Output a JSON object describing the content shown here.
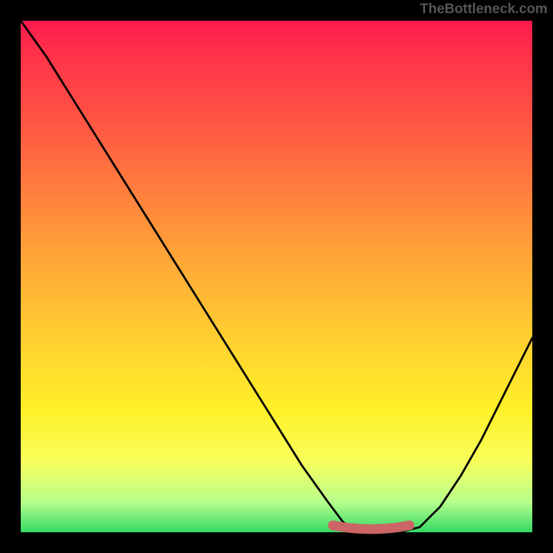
{
  "watermark": "TheBottleneck.com",
  "chart_data": {
    "type": "line",
    "title": "",
    "xlabel": "",
    "ylabel": "",
    "xlim": [
      0,
      100
    ],
    "ylim": [
      0,
      100
    ],
    "series": [
      {
        "name": "bottleneck-curve",
        "x": [
          0,
          5,
          10,
          15,
          20,
          25,
          30,
          35,
          40,
          45,
          50,
          55,
          60,
          63,
          66,
          70,
          74,
          78,
          82,
          86,
          90,
          94,
          98,
          100
        ],
        "y": [
          100,
          93,
          85,
          77,
          69,
          61,
          53,
          45,
          37,
          29,
          21,
          13,
          6,
          2,
          0,
          0,
          0,
          1,
          5,
          11,
          18,
          26,
          34,
          38
        ]
      }
    ],
    "gradient_stops": [
      {
        "pos": 0.0,
        "color": "#ff1a4d"
      },
      {
        "pos": 0.18,
        "color": "#ff5044"
      },
      {
        "pos": 0.46,
        "color": "#ffa538"
      },
      {
        "pos": 0.76,
        "color": "#fff028"
      },
      {
        "pos": 0.94,
        "color": "#b8ff8c"
      },
      {
        "pos": 1.0,
        "color": "#33d966"
      }
    ],
    "highlight_segment": {
      "color": "#cc6666",
      "x_range": [
        61,
        76
      ],
      "y": 0
    }
  }
}
